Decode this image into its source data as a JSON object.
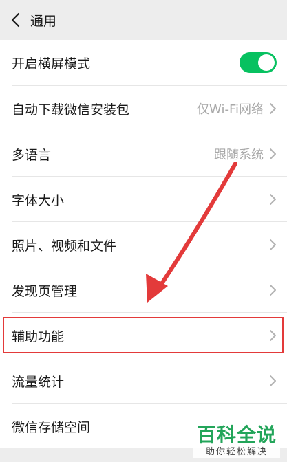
{
  "header": {
    "title": "通用",
    "back_icon": "chevron-left-icon"
  },
  "rows": [
    {
      "label": "开启横屏模式",
      "value": "",
      "control": "toggle",
      "toggle_on": true
    },
    {
      "label": "自动下载微信安装包",
      "value": "仅Wi-Fi网络",
      "control": "chevron"
    },
    {
      "label": "多语言",
      "value": "跟随系统",
      "control": "chevron"
    },
    {
      "label": "字体大小",
      "value": "",
      "control": "chevron"
    },
    {
      "label": "照片、视频和文件",
      "value": "",
      "control": "chevron"
    },
    {
      "label": "发现页管理",
      "value": "",
      "control": "chevron"
    },
    {
      "label": "辅助功能",
      "value": "",
      "control": "chevron",
      "highlighted": true
    },
    {
      "label": "流量统计",
      "value": "",
      "control": "chevron"
    },
    {
      "label": "微信存储空间",
      "value": "",
      "control": "chevron"
    }
  ],
  "colors": {
    "accent": "#07c160",
    "annotation": "#e33a3a",
    "background": "#ededed"
  },
  "watermark": {
    "main": "百科全说",
    "sub": "助你轻松解决"
  }
}
